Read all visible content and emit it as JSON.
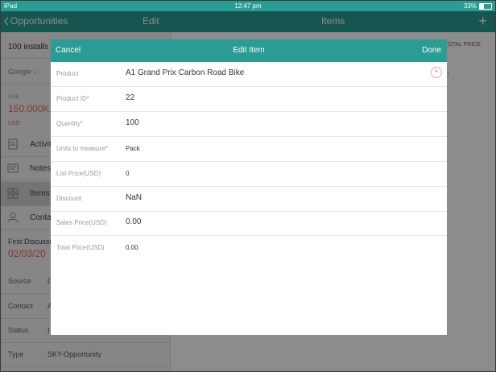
{
  "status_bar": {
    "carrier": "iPad",
    "time": "12:47 pm",
    "battery": "33%"
  },
  "navbar": {
    "back_label": "Opportunities",
    "edit_label": "Edit",
    "items_label": "Items",
    "add_label": "+"
  },
  "left_panel": {
    "deal_title": "100 installs",
    "company": "Google",
    "size_label": "SIZE",
    "size_value": "150.000K",
    "size_currency": "USD",
    "nav_items": [
      {
        "label": "Activities",
        "icon": "clipboard-icon"
      },
      {
        "label": "Notes",
        "icon": "notes-icon"
      },
      {
        "label": "Items",
        "icon": "items-icon"
      },
      {
        "label": "Contacts",
        "icon": "contact-icon"
      }
    ],
    "first_discussion_label": "First Discussion",
    "first_discussion_value": "02/03/20",
    "details": [
      {
        "label": "Source",
        "value": "C"
      },
      {
        "label": "Contact",
        "value": "A"
      },
      {
        "label": "Status",
        "value": "I"
      },
      {
        "label": "Type",
        "value": "SKY-Opportunity"
      }
    ]
  },
  "right_panel": {
    "header": "TOTAL PRICE",
    "value": "0"
  },
  "modal": {
    "cancel_label": "Cancel",
    "title": "Edit Item",
    "done_label": "Done",
    "fields": [
      {
        "label": "Product",
        "value": "A1 Grand Prix Carbon Road Bike"
      },
      {
        "label": "Product ID*",
        "value": "22"
      },
      {
        "label": "Quantity*",
        "value": "100"
      },
      {
        "label": "Units to measure*",
        "value": "Pack"
      },
      {
        "label": "List Price(USD)",
        "value": "0"
      },
      {
        "label": "Discount",
        "value": "NaN"
      },
      {
        "label": "Sales Price(USD)",
        "value": "0.00"
      },
      {
        "label": "Total Price(USD)",
        "value": "0.00"
      }
    ]
  },
  "colors": {
    "accent": "#2a9c94",
    "highlight": "#e26a6a"
  }
}
